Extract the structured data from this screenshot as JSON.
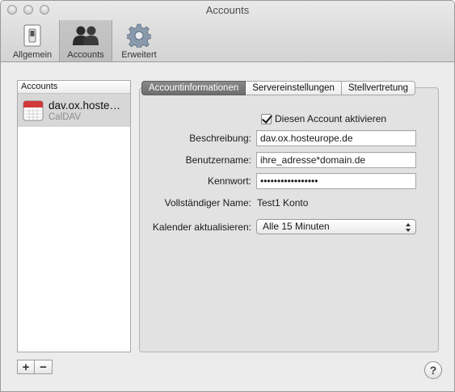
{
  "window": {
    "title": "Accounts"
  },
  "toolbar": {
    "items": [
      {
        "label": "Allgemein",
        "icon": "switch-icon"
      },
      {
        "label": "Accounts",
        "icon": "accounts-icon",
        "selected": true
      },
      {
        "label": "Erweitert",
        "icon": "gear-icon"
      }
    ]
  },
  "accounts": {
    "header": "Accounts",
    "items": [
      {
        "name": "dav.ox.hoste…",
        "type": "CalDAV",
        "icon": "calendar-icon",
        "selected": true
      }
    ],
    "add_label": "+",
    "remove_label": "−"
  },
  "tabs": [
    {
      "label": "Accountinformationen",
      "active": true
    },
    {
      "label": "Servereinstellungen"
    },
    {
      "label": "Stellvertretung"
    }
  ],
  "form": {
    "enable_label": "Diesen Account aktivieren",
    "enable_checked": true,
    "description_label": "Beschreibung:",
    "description_value": "dav.ox.hosteurope.de",
    "username_label": "Benutzername:",
    "username_value": "ihre_adresse*domain.de",
    "password_label": "Kennwort:",
    "password_value": "•••••••••••••••••",
    "fullname_label": "Vollständiger Name:",
    "fullname_value": "Test1 Konto",
    "refresh_label": "Kalender aktualisieren:",
    "refresh_value": "Alle 15 Minuten"
  },
  "help_label": "?",
  "colors": {
    "selected_row": "#d7d7d7",
    "active_tab": "#6d6d6d",
    "calendar_red": "#d03a3a"
  }
}
